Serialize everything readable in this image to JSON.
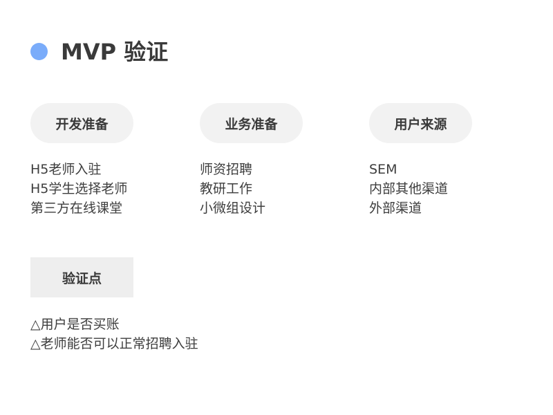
{
  "title": {
    "dot_color": "#7aacfa",
    "text": "MVP 验证"
  },
  "columns": [
    {
      "heading": "开发准备",
      "items": [
        "H5老师入驻",
        "H5学生选择老师",
        "第三方在线课堂"
      ]
    },
    {
      "heading": "业务准备",
      "items": [
        "师资招聘",
        "教研工作",
        "小微组设计"
      ]
    },
    {
      "heading": "用户来源",
      "items": [
        "SEM",
        "内部其他渠道",
        "外部渠道"
      ]
    }
  ],
  "verification": {
    "heading": "验证点",
    "items": [
      "△用户是否买账",
      "△老师能否可以正常招聘入驻"
    ]
  }
}
